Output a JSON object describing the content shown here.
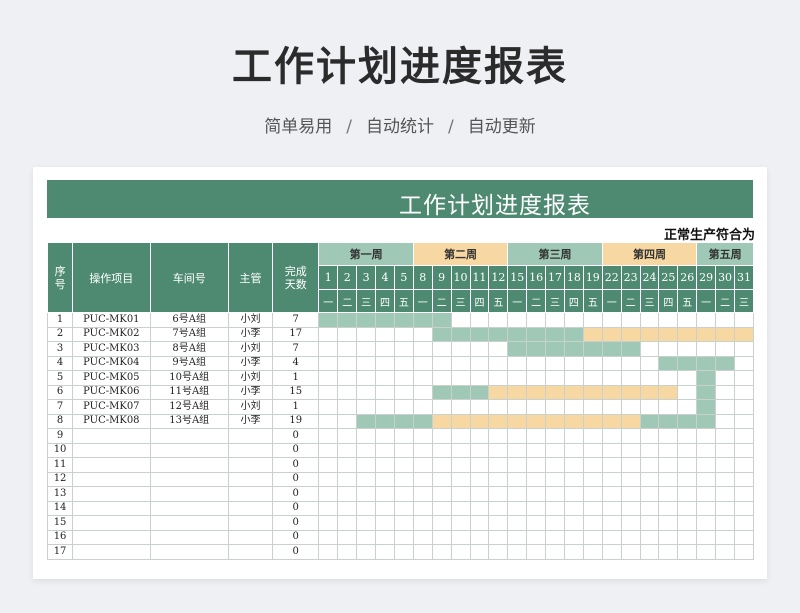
{
  "page": {
    "title": "工作计划进度报表",
    "subtitle_items": [
      "简单易用",
      "自动统计",
      "自动更新"
    ],
    "subtitle_sep": "/"
  },
  "sheet": {
    "banner_title": "工作计划进度报表",
    "status_note": "正常生产符合为",
    "headers": {
      "seq": "序号",
      "item": "操作项目",
      "workshop": "车间号",
      "manager": "主管",
      "days": "完成天数"
    },
    "weeks": [
      {
        "label": "第一周",
        "span": 5,
        "color": "#9fc8b6"
      },
      {
        "label": "第二周",
        "span": 5,
        "color": "#f7d7a2"
      },
      {
        "label": "第三周",
        "span": 5,
        "color": "#9fc8b6"
      },
      {
        "label": "第四周",
        "span": 5,
        "color": "#f7d7a2"
      },
      {
        "label": "第五周",
        "span": 3,
        "color": "#9fc8b6"
      }
    ],
    "days": [
      "1",
      "2",
      "3",
      "4",
      "5",
      "8",
      "9",
      "10",
      "11",
      "12",
      "15",
      "16",
      "17",
      "18",
      "19",
      "22",
      "23",
      "24",
      "25",
      "26",
      "29",
      "30",
      "31"
    ],
    "weekdays": [
      "一",
      "二",
      "三",
      "四",
      "五",
      "一",
      "二",
      "三",
      "四",
      "五",
      "一",
      "二",
      "三",
      "四",
      "五",
      "一",
      "二",
      "三",
      "四",
      "五",
      "一",
      "二",
      "三"
    ],
    "colors": {
      "header_green": "#4e8a72",
      "bar_green": "#9fc8b6",
      "bar_orange": "#f7d7a2"
    },
    "rows": [
      {
        "no": "1",
        "item": "PUC-MK01",
        "workshop": "6号A组",
        "manager": "小刘",
        "days": "7",
        "bars": "GGGGGGG................"
      },
      {
        "no": "2",
        "item": "PUC-MK02",
        "workshop": "7号A组",
        "manager": "小李",
        "days": "17",
        "bars": "......GGGGGGGGOOOOOOOOO"
      },
      {
        "no": "3",
        "item": "PUC-MK03",
        "workshop": "8号A组",
        "manager": "小刘",
        "days": "7",
        "bars": "..........GGGGGGG......"
      },
      {
        "no": "4",
        "item": "PUC-MK04",
        "workshop": "9号A组",
        "manager": "小李",
        "days": "4",
        "bars": "..................GGGG."
      },
      {
        "no": "5",
        "item": "PUC-MK05",
        "workshop": "10号A组",
        "manager": "小刘",
        "days": "1",
        "bars": "....................G.."
      },
      {
        "no": "6",
        "item": "PUC-MK06",
        "workshop": "11号A组",
        "manager": "小李",
        "days": "15",
        "bars": "......GGGOOOOOOOOOO.G.."
      },
      {
        "no": "7",
        "item": "PUC-MK07",
        "workshop": "12号A组",
        "manager": "小刘",
        "days": "1",
        "bars": "....................G.."
      },
      {
        "no": "8",
        "item": "PUC-MK08",
        "workshop": "13号A组",
        "manager": "小李",
        "days": "19",
        "bars": "..GGGGOOOOOOOOOOOGGGG.."
      },
      {
        "no": "9",
        "item": "",
        "workshop": "",
        "manager": "",
        "days": "0",
        "bars": ""
      },
      {
        "no": "10",
        "item": "",
        "workshop": "",
        "manager": "",
        "days": "0",
        "bars": ""
      },
      {
        "no": "11",
        "item": "",
        "workshop": "",
        "manager": "",
        "days": "0",
        "bars": ""
      },
      {
        "no": "12",
        "item": "",
        "workshop": "",
        "manager": "",
        "days": "0",
        "bars": ""
      },
      {
        "no": "13",
        "item": "",
        "workshop": "",
        "manager": "",
        "days": "0",
        "bars": ""
      },
      {
        "no": "14",
        "item": "",
        "workshop": "",
        "manager": "",
        "days": "0",
        "bars": ""
      },
      {
        "no": "15",
        "item": "",
        "workshop": "",
        "manager": "",
        "days": "0",
        "bars": ""
      },
      {
        "no": "16",
        "item": "",
        "workshop": "",
        "manager": "",
        "days": "0",
        "bars": ""
      },
      {
        "no": "17",
        "item": "",
        "workshop": "",
        "manager": "",
        "days": "0",
        "bars": ""
      }
    ]
  }
}
